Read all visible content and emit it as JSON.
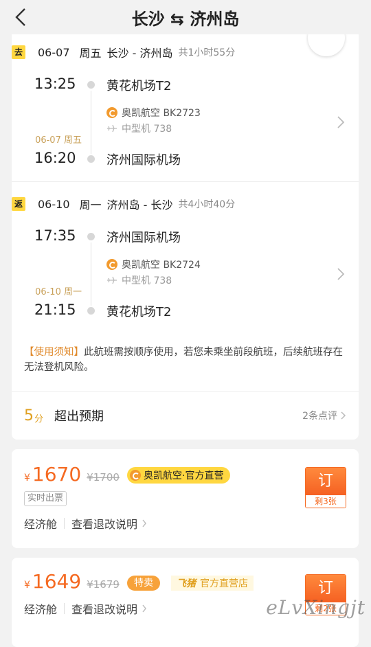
{
  "header": {
    "title": "长沙 ⇆ 济州岛"
  },
  "outbound": {
    "badge": "去",
    "date": "06-07",
    "weekday": "周五",
    "route": "长沙 - 济州岛",
    "duration": "共1小时55分",
    "dep_time": "13:25",
    "dep_airport": "黄花机场T2",
    "airline": "奥凯航空 BK2723",
    "aircraft": "中型机 738",
    "arr_date": "06-07 周五",
    "arr_time": "16:20",
    "arr_airport": "济州国际机场"
  },
  "return": {
    "badge": "返",
    "date": "06-10",
    "weekday": "周一",
    "route": "济州岛 - 长沙",
    "duration": "共4小时40分",
    "dep_time": "17:35",
    "dep_airport": "济州国际机场",
    "airline": "奥凯航空 BK2724",
    "aircraft": "中型机 738",
    "arr_date": "06-10 周一",
    "arr_time": "21:15",
    "arr_airport": "黄花机场T2"
  },
  "notice": {
    "tag": "【使用须知】",
    "text": "此航班需按顺序使用，若您未乘坐前段航班，后续航班存在无法登机风险。"
  },
  "rating": {
    "score": "5",
    "unit": "分",
    "label": "超出预期",
    "count": "2条点评"
  },
  "offers": [
    {
      "currency": "¥",
      "price": "1670",
      "old_price": "¥1700",
      "tag": "奥凯航空·官方直营",
      "realtime": "实时出票",
      "cabin": "经济舱",
      "refund": "查看退改说明",
      "book_label": "订",
      "remaining": "剩3张"
    },
    {
      "currency": "¥",
      "price": "1649",
      "old_price": "¥1679",
      "sale_tag": "特卖",
      "store_logo": "飞猪",
      "store_tag": "官方直营店",
      "cabin": "经济舱",
      "refund": "查看退改说明",
      "book_label": "订",
      "remaining": "剩2张"
    }
  ],
  "watermark": "eLvXingjt"
}
